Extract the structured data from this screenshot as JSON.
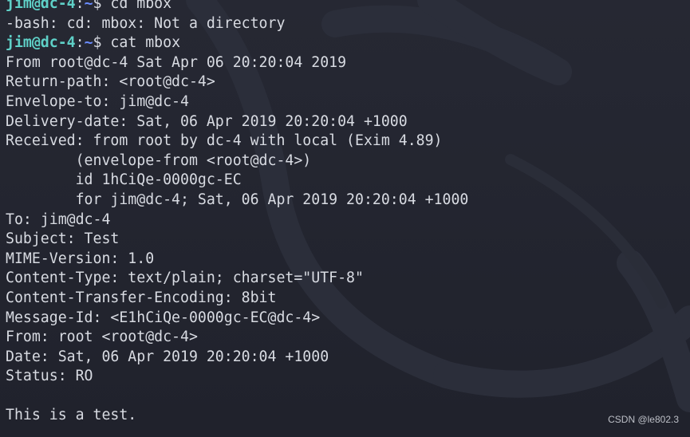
{
  "theme": {
    "background": "#232530",
    "text": "#d8dbe2",
    "prompt_user_color": "#5fd0c7",
    "prompt_path_color": "#6a8cff"
  },
  "prompt": {
    "user_host": "jim@dc-4",
    "separator": ":",
    "path": "~",
    "sign": "$ "
  },
  "terminal": {
    "lines": [
      {
        "type": "prompt",
        "command": "cd mbox"
      },
      {
        "type": "output",
        "text": "-bash: cd: mbox: Not a directory"
      },
      {
        "type": "prompt",
        "command": "cat mbox"
      },
      {
        "type": "output",
        "text": "From root@dc-4 Sat Apr 06 20:20:04 2019"
      },
      {
        "type": "output",
        "text": "Return-path: <root@dc-4>"
      },
      {
        "type": "output",
        "text": "Envelope-to: jim@dc-4"
      },
      {
        "type": "output",
        "text": "Delivery-date: Sat, 06 Apr 2019 20:20:04 +1000"
      },
      {
        "type": "output",
        "text": "Received: from root by dc-4 with local (Exim 4.89)"
      },
      {
        "type": "output",
        "text": "        (envelope-from <root@dc-4>)"
      },
      {
        "type": "output",
        "text": "        id 1hCiQe-0000gc-EC"
      },
      {
        "type": "output",
        "text": "        for jim@dc-4; Sat, 06 Apr 2019 20:20:04 +1000"
      },
      {
        "type": "output",
        "text": "To: jim@dc-4"
      },
      {
        "type": "output",
        "text": "Subject: Test"
      },
      {
        "type": "output",
        "text": "MIME-Version: 1.0"
      },
      {
        "type": "output",
        "text": "Content-Type: text/plain; charset=\"UTF-8\""
      },
      {
        "type": "output",
        "text": "Content-Transfer-Encoding: 8bit"
      },
      {
        "type": "output",
        "text": "Message-Id: <E1hCiQe-0000gc-EC@dc-4>"
      },
      {
        "type": "output",
        "text": "From: root <root@dc-4>"
      },
      {
        "type": "output",
        "text": "Date: Sat, 06 Apr 2019 20:20:04 +1000"
      },
      {
        "type": "output",
        "text": "Status: RO"
      },
      {
        "type": "output",
        "text": ""
      },
      {
        "type": "output",
        "text": "This is a test."
      }
    ]
  },
  "watermark": {
    "text": "CSDN @le802.3"
  }
}
